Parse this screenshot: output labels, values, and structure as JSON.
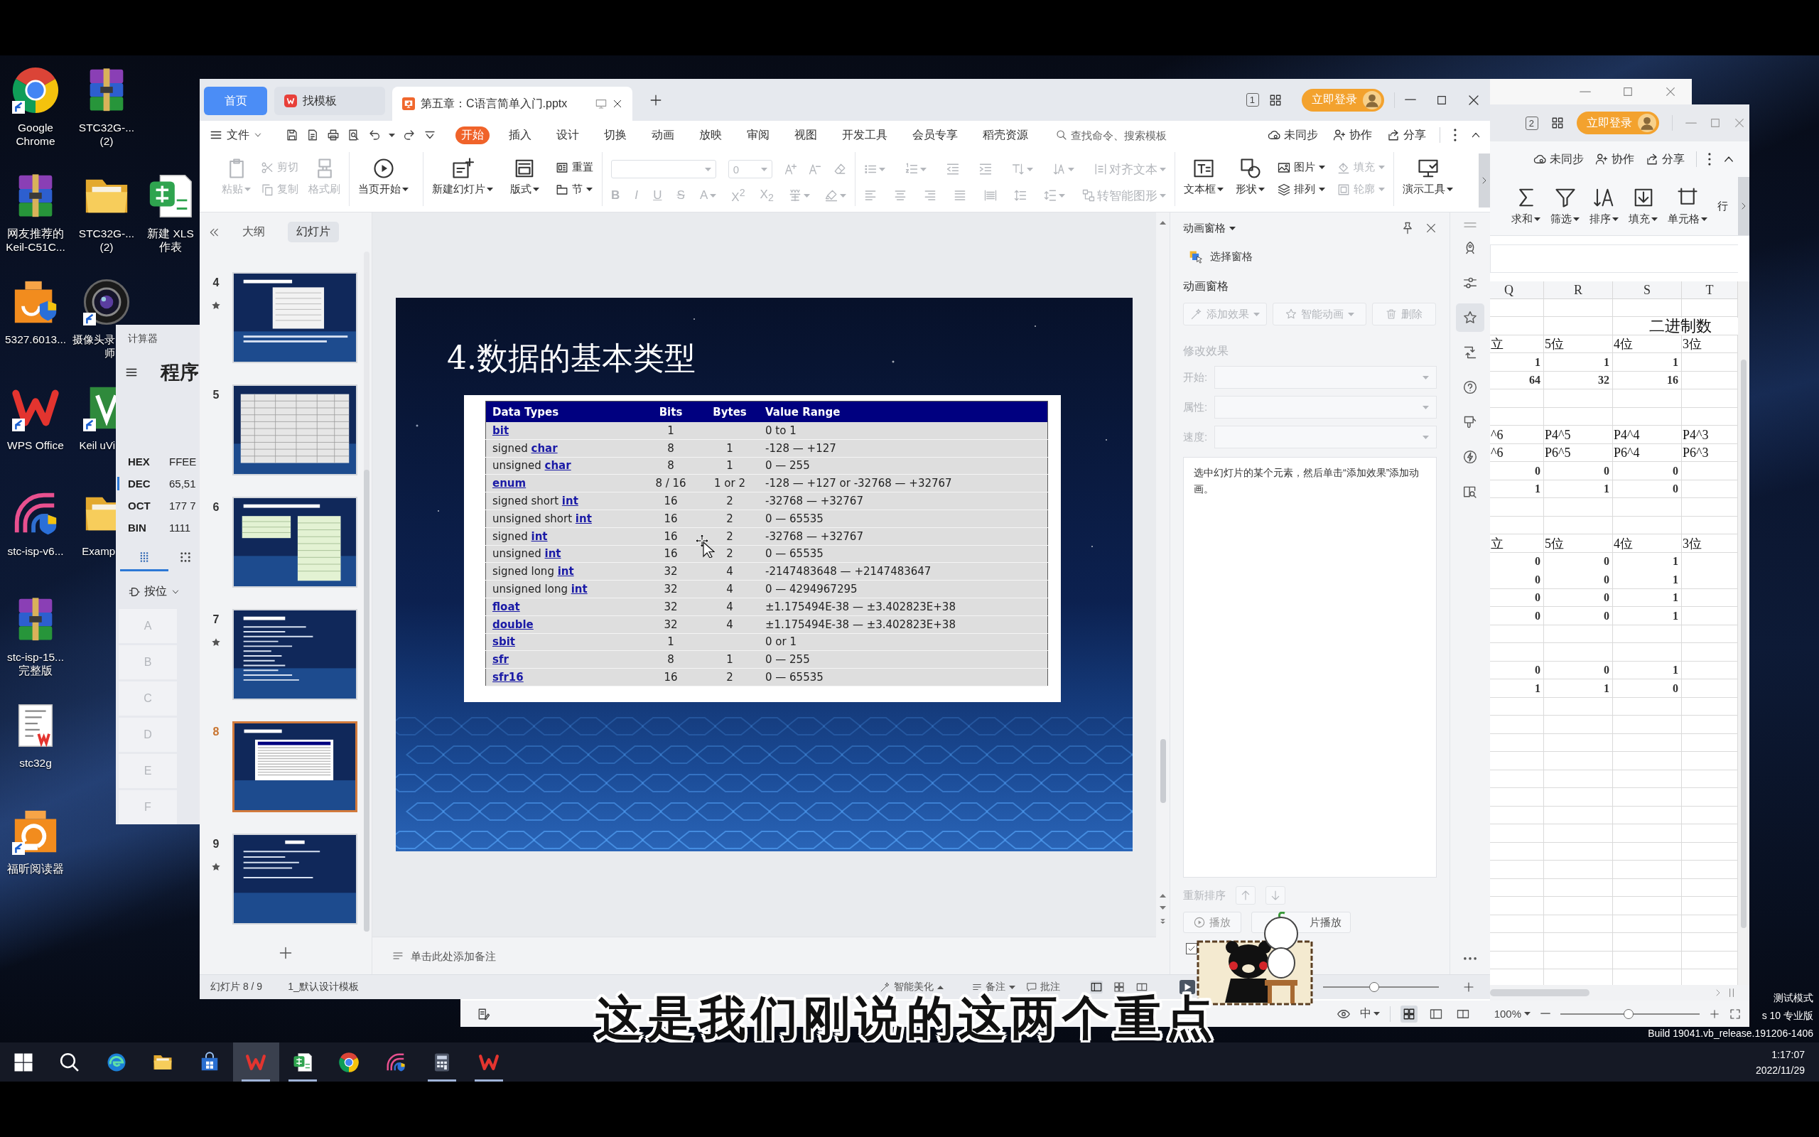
{
  "desktop": {
    "columns": [
      [
        "Google\nChrome",
        "网友推荐的\nKeil-C51C...",
        "5327.6013...",
        "WPS Office",
        "stc-isp-v6...",
        "stc-isp-15...\n完整版",
        "stc32g",
        "福昕阅读器"
      ],
      [
        "STC32G-...\n(2)",
        "STC32G-...\n(2)",
        "摄像头录师",
        "Keil uVi",
        "Examp"
      ],
      [
        "新建 XLS\n作表"
      ]
    ],
    "system_notice": [
      "测试模式",
      "s 10 专业版",
      "Build 19041.vb_release.191206-1406"
    ]
  },
  "calculator": {
    "title": "计算器",
    "mode": "程序",
    "readouts": [
      {
        "base": "HEX",
        "value": "FFEE",
        "selected": false
      },
      {
        "base": "DEC",
        "value": "65,51",
        "selected": true
      },
      {
        "base": "OCT",
        "value": "177 7",
        "selected": false
      },
      {
        "base": "BIN",
        "value": "1111",
        "selected": false
      }
    ],
    "tabs": [
      {
        "selected": true
      },
      {
        "selected": false
      }
    ],
    "bitwise": "按位",
    "keys": [
      {
        "label": "A",
        "disabled": true
      },
      {
        "label": "B",
        "disabled": true
      },
      {
        "label": "C",
        "disabled": true
      },
      {
        "label": "D",
        "disabled": true
      },
      {
        "label": "E",
        "disabled": true
      },
      {
        "label": "F",
        "disabled": true
      }
    ]
  },
  "spreadsheet": {
    "window_count": "2",
    "login": "立即登录",
    "actions": [
      "未同步",
      "协作",
      "分享"
    ],
    "ribbon": [
      {
        "label": "求和",
        "dropdown": true
      },
      {
        "label": "筛选",
        "dropdown": true
      },
      {
        "label": "排序",
        "dropdown": true
      },
      {
        "label": "填充",
        "dropdown": true
      },
      {
        "label": "单元格",
        "dropdown": true
      },
      {
        "label": "行",
        "dropdown": false
      }
    ],
    "columns": [
      "Q",
      "R",
      "S",
      "T"
    ],
    "title": "二进制数",
    "blocks": [
      {
        "rows": [
          {
            "kind": "label",
            "cells": [
              "立",
              "5位",
              "4位",
              "3位"
            ]
          },
          {
            "kind": "number",
            "cells": [
              "1",
              "1",
              "1"
            ]
          },
          {
            "kind": "number",
            "cells": [
              "64",
              "32",
              "16"
            ]
          }
        ]
      },
      {
        "rows": [
          {
            "kind": "label",
            "cells": [
              "^6",
              "P4^5",
              "P4^4",
              "P4^3"
            ]
          },
          {
            "kind": "label",
            "cells": [
              "^6",
              "P6^5",
              "P6^4",
              "P6^3"
            ]
          },
          {
            "kind": "number",
            "cells": [
              "0",
              "0",
              "0"
            ]
          },
          {
            "kind": "number",
            "cells": [
              "1",
              "1",
              "0"
            ]
          }
        ]
      },
      {
        "rows": [
          {
            "kind": "label",
            "cells": [
              "立",
              "5位",
              "4位",
              "3位"
            ]
          },
          {
            "kind": "number",
            "cells": [
              "0",
              "0",
              "1"
            ]
          },
          {
            "kind": "number",
            "cells": [
              "0",
              "0",
              "1"
            ]
          },
          {
            "kind": "number",
            "cells": [
              "0",
              "0",
              "1"
            ]
          },
          {
            "kind": "number",
            "cells": [
              "0",
              "0",
              "1"
            ]
          }
        ]
      },
      {
        "rows": [
          {
            "kind": "number",
            "cells": [
              "0",
              "0",
              "1"
            ]
          },
          {
            "kind": "number",
            "cells": [
              "1",
              "1",
              "0"
            ]
          }
        ]
      }
    ],
    "status": {
      "input_mode": "中",
      "views": [
        {
          "selected": true
        },
        {
          "selected": false
        },
        {
          "selected": false
        }
      ],
      "zoom": "100%",
      "zoom_slider": {
        "level": 0.49
      }
    }
  },
  "presentation": {
    "tabs": [
      {
        "label": "首页",
        "kind": "home",
        "selected": false
      },
      {
        "label": "找模板",
        "kind": "page",
        "selected": false
      },
      {
        "label": "第五章：C语言简单入门.pptx",
        "kind": "document",
        "selected": true
      }
    ],
    "window_count": "1",
    "login": "立即登录",
    "file_menu": "文件",
    "menu_tabs": [
      {
        "label": "开始",
        "selected": true
      },
      {
        "label": "插入",
        "selected": false
      },
      {
        "label": "设计",
        "selected": false
      },
      {
        "label": "切换",
        "selected": false
      },
      {
        "label": "动画",
        "selected": false
      },
      {
        "label": "放映",
        "selected": false
      },
      {
        "label": "审阅",
        "selected": false
      },
      {
        "label": "视图",
        "selected": false
      },
      {
        "label": "开发工具",
        "selected": false
      },
      {
        "label": "会员专享",
        "selected": false
      },
      {
        "label": "稻壳资源",
        "selected": false
      }
    ],
    "search": {
      "placeholder": "查找命令、搜索模板"
    },
    "actions": [
      "未同步",
      "协作",
      "分享"
    ],
    "ribbon": [
      [
        {
          "kind": "large",
          "label": "粘贴",
          "dropdown": true,
          "disabled": true
        },
        {
          "kind": "stack",
          "rows": [
            {
              "label": "剪切",
              "dropdown": false,
              "disabled": true
            },
            {
              "label": "复制",
              "dropdown": false,
              "disabled": true
            }
          ]
        },
        {
          "kind": "large",
          "label": "格式刷",
          "dropdown": false,
          "disabled": true
        }
      ],
      [
        {
          "kind": "large",
          "label": "当页开始",
          "dropdown": true,
          "disabled": false
        }
      ],
      [
        {
          "kind": "large",
          "label": "新建幻灯片",
          "dropdown": true,
          "disabled": false
        },
        {
          "kind": "large",
          "label": "版式",
          "dropdown": true,
          "disabled": false
        },
        {
          "kind": "stack",
          "rows": [
            {
              "label": "重置",
              "dropdown": false,
              "disabled": false
            },
            {
              "label": "节",
              "dropdown": true,
              "disabled": false
            }
          ]
        }
      ],
      [
        {
          "kind": "grid",
          "upper": [
            {
              "kind": "field",
              "disabled": true
            },
            {
              "kind": "field",
              "value": "0",
              "disabled": true
            },
            {
              "kind": "button",
              "dropdown": false,
              "disabled": true
            },
            {
              "kind": "button",
              "dropdown": false,
              "disabled": true
            },
            {
              "kind": "button",
              "dropdown": false,
              "disabled": true
            }
          ],
          "lower": [
            {
              "kind": "button",
              "label": "B",
              "dropdown": false,
              "disabled": true
            },
            {
              "kind": "button",
              "label": "I",
              "dropdown": false,
              "disabled": true
            },
            {
              "kind": "button",
              "label": "U",
              "dropdown": false,
              "disabled": true
            },
            {
              "kind": "button",
              "label": "S",
              "dropdown": false,
              "disabled": true
            },
            {
              "kind": "button",
              "label": "A",
              "dropdown": true,
              "disabled": true
            },
            {
              "kind": "button",
              "label": "X$^{2}$",
              "dropdown": false,
              "disabled": true
            },
            {
              "kind": "button",
              "label": "X$_{2}$",
              "dropdown": false,
              "disabled": true
            },
            {
              "kind": "button",
              "dropdown": true,
              "disabled": true
            },
            {
              "kind": "button",
              "dropdown": true,
              "disabled": true
            }
          ]
        }
      ],
      [
        {
          "kind": "grid",
          "upper": [
            {
              "kind": "button",
              "dropdown": true,
              "disabled": true
            },
            {
              "kind": "button",
              "dropdown": true,
              "disabled": true
            },
            {
              "kind": "button",
              "dropdown": false,
              "disabled": true
            },
            {
              "kind": "button",
              "dropdown": false,
              "disabled": true
            },
            {
              "kind": "button",
              "dropdown": true,
              "disabled": true
            },
            {
              "kind": "button",
              "dropdown": true,
              "disabled": true
            },
            {
              "kind": "button",
              "label": "对齐文本",
              "dropdown": true,
              "disabled": true
            }
          ],
          "lower": [
            {
              "kind": "button",
              "dropdown": false,
              "disabled": true
            },
            {
              "kind": "button",
              "dropdown": false,
              "disabled": true
            },
            {
              "kind": "button",
              "dropdown": false,
              "disabled": true
            },
            {
              "kind": "button",
              "dropdown": false,
              "disabled": true
            },
            {
              "kind": "button",
              "dropdown": false,
              "disabled": true
            },
            {
              "kind": "button",
              "dropdown": false,
              "disabled": true
            },
            {
              "kind": "button",
              "dropdown": true,
              "disabled": true
            },
            {
              "kind": "button",
              "label": "转智能图形",
              "dropdown": true,
              "disabled": true
            }
          ]
        }
      ],
      [
        {
          "kind": "large",
          "label": "文本框",
          "dropdown": true,
          "disabled": false
        },
        {
          "kind": "large",
          "label": "形状",
          "dropdown": true,
          "disabled": false
        },
        {
          "kind": "stack",
          "rows": [
            {
              "label": "图片",
              "dropdown": true,
              "disabled": false
            },
            {
              "label": "排列",
              "dropdown": true,
              "disabled": false
            }
          ]
        },
        {
          "kind": "stack",
          "rows": [
            {
              "label": "填充",
              "dropdown": true,
              "disabled": true
            },
            {
              "label": "轮廓",
              "dropdown": true,
              "disabled": true
            }
          ]
        }
      ],
      [
        {
          "kind": "large",
          "label": "演示工具",
          "dropdown": true,
          "disabled": false
        }
      ]
    ],
    "slides": {
      "tabs": [
        {
          "label": "大纲",
          "selected": false
        },
        {
          "label": "幻灯片",
          "selected": true
        }
      ],
      "items": [
        {
          "number": "4",
          "animated": true,
          "selected": false
        },
        {
          "number": "5",
          "animated": false,
          "selected": false
        },
        {
          "number": "6",
          "animated": false,
          "selected": false
        },
        {
          "number": "7",
          "animated": true,
          "selected": false
        },
        {
          "number": "8",
          "animated": false,
          "selected": true
        },
        {
          "number": "9",
          "animated": true,
          "selected": false
        }
      ]
    },
    "slide": {
      "title": "4.数据的基本类型",
      "table": {
        "columns": [
          "Data Types",
          "Bits",
          "Bytes",
          "Value Range"
        ],
        "rows": [
          {
            "type": {
              "link": "bit"
            },
            "bits": "1",
            "range": "0 to 1"
          },
          {
            "type": {
              "text": "signed",
              "link": "char"
            },
            "bits": "8",
            "bytes": "1",
            "range": "-128 — +127"
          },
          {
            "type": {
              "text": "unsigned",
              "link": "char"
            },
            "bits": "8",
            "bytes": "1",
            "range": "0 — 255"
          },
          {
            "type": {
              "link": "enum"
            },
            "bits": "8 / 16",
            "bytes": "1 or 2",
            "range": "-128 — +127 or -32768 — +32767"
          },
          {
            "type": {
              "text": "signed short",
              "link": "int"
            },
            "bits": "16",
            "bytes": "2",
            "range": "-32768 — +32767"
          },
          {
            "type": {
              "text": "unsigned short",
              "link": "int"
            },
            "bits": "16",
            "bytes": "2",
            "range": "0 — 65535"
          },
          {
            "type": {
              "text": "signed",
              "link": "int"
            },
            "bits": "16",
            "bytes": "2",
            "range": "-32768 — +32767"
          },
          {
            "type": {
              "text": "unsigned",
              "link": "int"
            },
            "bits": "16",
            "bytes": "2",
            "range": "0 — 65535"
          },
          {
            "type": {
              "text": "signed long",
              "link": "int"
            },
            "bits": "32",
            "bytes": "4",
            "range": "-2147483648 — +2147483647"
          },
          {
            "type": {
              "text": "unsigned long",
              "link": "int"
            },
            "bits": "32",
            "bytes": "4",
            "range": "0 — 4294967295"
          },
          {
            "type": {
              "link": "float"
            },
            "bits": "32",
            "bytes": "4",
            "range": "±1.175494E-38 — ±3.402823E+38"
          },
          {
            "type": {
              "link": "double"
            },
            "bits": "32",
            "bytes": "4",
            "range": "±1.175494E-38 — ±3.402823E+38"
          },
          {
            "type": {
              "link": "sbit"
            },
            "bits": "1",
            "range": "0 or 1"
          },
          {
            "type": {
              "link": "sfr"
            },
            "bits": "8",
            "bytes": "1",
            "range": "0 — 255"
          },
          {
            "type": {
              "link": "sfr16"
            },
            "bits": "16",
            "bytes": "2",
            "range": "0 — 65535"
          }
        ]
      }
    },
    "notes": {
      "placeholder": "单击此处添加备注"
    },
    "animation_pane": {
      "header": "动画窗格",
      "select_pane": "选择窗格",
      "title": "动画窗格",
      "buttons": [
        {
          "label": "添加效果",
          "dropdown": true,
          "disabled": true
        },
        {
          "label": "智能动画",
          "dropdown": true,
          "disabled": true
        },
        {
          "label": "删除",
          "dropdown": false,
          "disabled": true
        }
      ],
      "modify": {
        "label": "修改效果",
        "disabled": true
      },
      "fields": [
        {
          "label": "开始:",
          "disabled": true
        },
        {
          "label": "属性:",
          "disabled": true
        },
        {
          "label": "速度:",
          "disabled": true
        }
      ],
      "hint": "选中幻灯片的某个元素，然后单击“添加效果”添加动画。",
      "reorder": {
        "label": "重新排序",
        "buttons": [
          {
            "disabled": true
          },
          {
            "disabled": true
          }
        ]
      },
      "play": "播放",
      "slideshow": "片播放",
      "auto_preview": {
        "checked": true
      }
    },
    "side_toolbar": [
      {
        "selected": false
      },
      {
        "selected": false
      },
      {
        "selected": true
      },
      {
        "selected": false
      },
      {
        "selected": false
      },
      {
        "selected": false
      },
      {
        "selected": false
      },
      {
        "selected": false
      }
    ],
    "status_bar": {
      "slide": "幻灯片 8 / 9",
      "template": "1_默认设计模板",
      "beautify": "智能美化",
      "notes": "备注",
      "comments": "批注",
      "views": [
        {
          "selected": true
        },
        {
          "selected": false
        },
        {
          "selected": false
        }
      ],
      "zoom": {
        "level": 0.44
      }
    }
  },
  "subtitle": "这是我们刚说的这两个重点",
  "taskbar": {
    "apps": [
      {
        "running": false,
        "selected": false
      },
      {
        "running": false,
        "selected": false
      },
      {
        "running": false,
        "selected": false
      },
      {
        "running": true,
        "selected": true
      },
      {
        "running": true,
        "selected": false
      },
      {
        "running": false,
        "selected": false
      },
      {
        "running": false,
        "selected": false
      },
      {
        "running": true,
        "selected": false
      },
      {
        "running": true,
        "selected": false
      }
    ],
    "clock": {
      "time": "1:17:07",
      "date": "2022/11/29"
    }
  }
}
